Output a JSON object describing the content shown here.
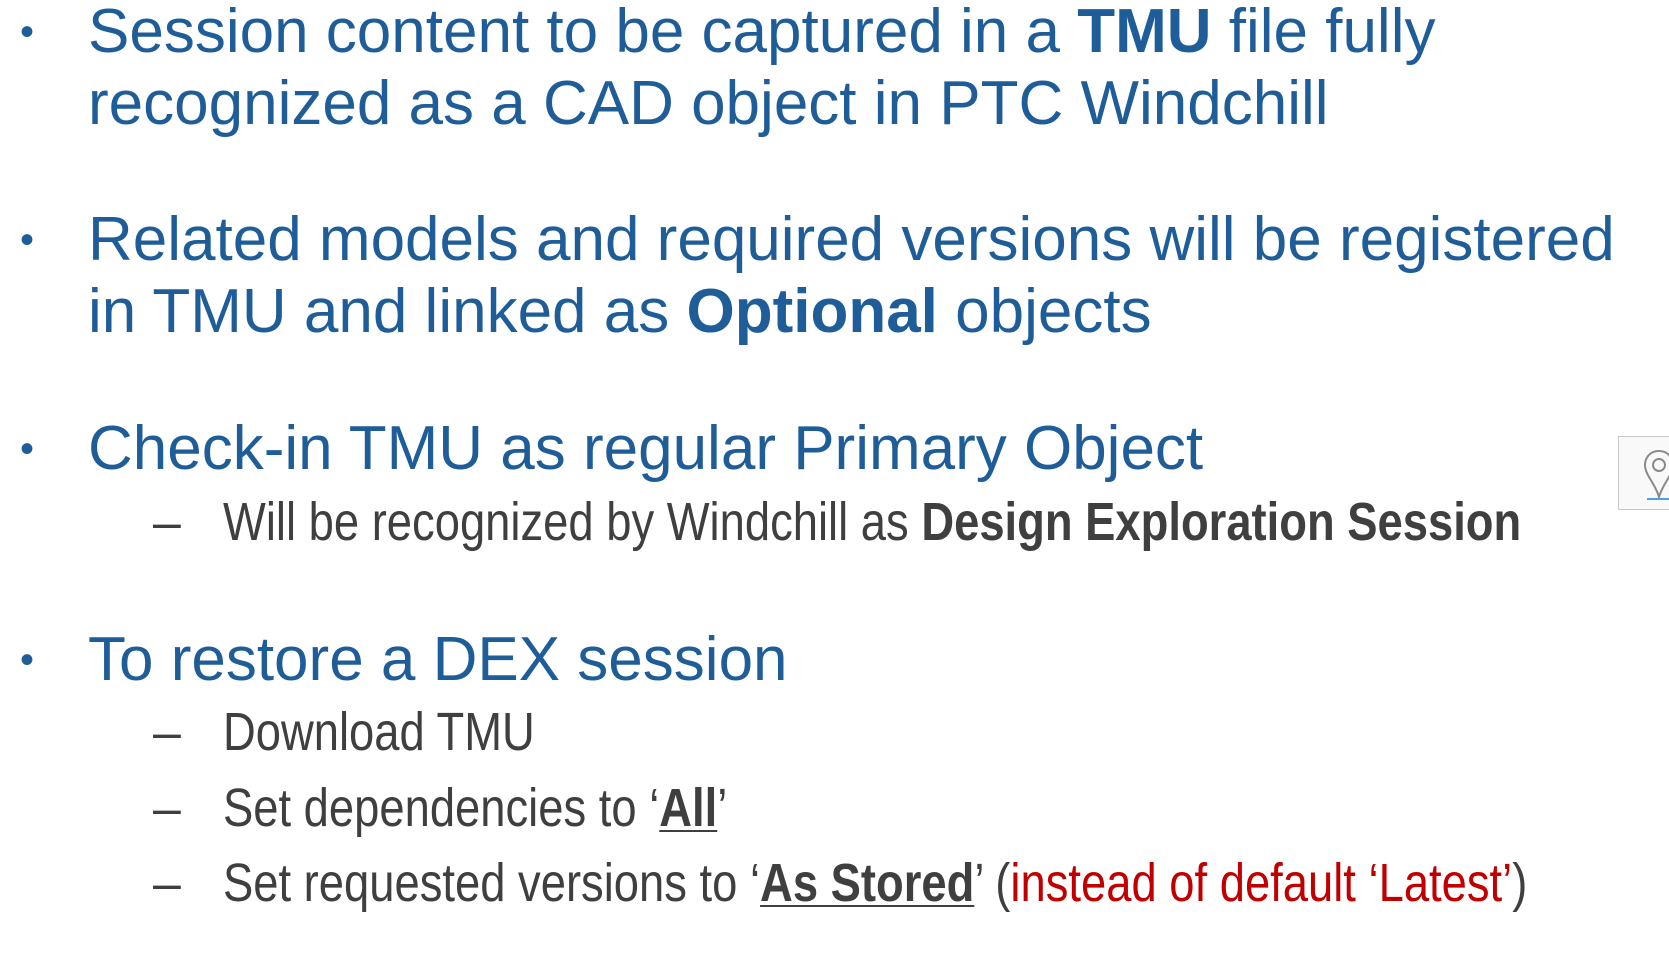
{
  "bullets": [
    {
      "lines": [
        {
          "parts": [
            {
              "text": "Session content to be captured in a "
            },
            {
              "text": "TMU",
              "bold": true
            },
            {
              "text": " file fully"
            }
          ]
        },
        {
          "parts": [
            {
              "text": "recognized as a CAD object in PTC Windchill"
            }
          ]
        }
      ],
      "sub": []
    },
    {
      "lines": [
        {
          "parts": [
            {
              "text": "Related models and required versions will be registered"
            }
          ]
        },
        {
          "parts": [
            {
              "text": "in TMU and linked as "
            },
            {
              "text": "Optional",
              "bold": true
            },
            {
              "text": " objects"
            }
          ]
        }
      ],
      "sub": []
    },
    {
      "lines": [
        {
          "parts": [
            {
              "text": "Check-in TMU as regular Primary Object"
            }
          ]
        }
      ],
      "sub": [
        {
          "parts": [
            {
              "text": "Will be recognized by Windchill as "
            },
            {
              "text": "Design Exploration Session",
              "bold": true
            }
          ]
        }
      ]
    },
    {
      "lines": [
        {
          "parts": [
            {
              "text": "To restore a DEX session"
            }
          ]
        }
      ],
      "sub": [
        {
          "parts": [
            {
              "text": "Download TMU"
            }
          ]
        },
        {
          "parts": [
            {
              "text": "Set dependencies to ‘"
            },
            {
              "text": "All",
              "bold": true,
              "underline": true
            },
            {
              "text": "’"
            }
          ]
        },
        {
          "parts": [
            {
              "text": "Set requested versions to ‘"
            },
            {
              "text": "As Stored",
              "bold": true,
              "underline": true
            },
            {
              "text": "’ ("
            },
            {
              "text": "instead of default ‘Latest’",
              "color": "#c00000"
            },
            {
              "text": ")"
            }
          ]
        }
      ]
    }
  ],
  "bullet_glyph": "•",
  "dash_glyph": "–",
  "colors": {
    "level1": "#1f5d99",
    "level2": "#3f3f3f",
    "highlight": "#c00000"
  },
  "side_icon": "map-pin-icon"
}
